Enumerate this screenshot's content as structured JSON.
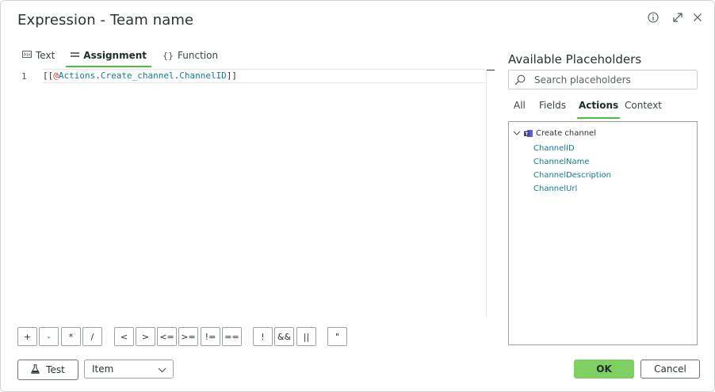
{
  "dialog": {
    "title": "Expression - Team name"
  },
  "editor_tabs": [
    {
      "label": "Text",
      "icon": "text-icon"
    },
    {
      "label": "Assignment",
      "icon": "equals-icon"
    },
    {
      "label": "Function",
      "icon": "braces-icon"
    }
  ],
  "active_editor_tab": "Assignment",
  "editor": {
    "line_number": "1",
    "code_open": "[[",
    "code_at": "@",
    "code_tok1": "Actions",
    "code_dot1": ".",
    "code_tok2": "Create_channel",
    "code_dot2": ".",
    "code_tok3": "ChannelID",
    "code_close": "]]"
  },
  "operators": [
    "+",
    "-",
    "*",
    "/",
    "<",
    ">",
    "<=",
    ">=",
    "!=",
    "==",
    "!",
    "&&",
    "||",
    "\""
  ],
  "test_button": {
    "label": "Test"
  },
  "item_select": {
    "value": "Item"
  },
  "placeholders": {
    "title": "Available Placeholders",
    "search_placeholder": "Search placeholders",
    "tabs": [
      "All",
      "Fields",
      "Actions",
      "Context"
    ],
    "active_tab": "Actions",
    "tree": {
      "group_label": "Create channel",
      "items": [
        "ChannelID",
        "ChannelName",
        "ChannelDescription",
        "ChannelUrl"
      ]
    }
  },
  "footer": {
    "ok_label": "OK",
    "cancel_label": "Cancel"
  },
  "colors": {
    "accent": "#53b94a",
    "ok_button": "#7fcf63",
    "token": "#0f7f8c",
    "at_sign": "#d6334a"
  }
}
